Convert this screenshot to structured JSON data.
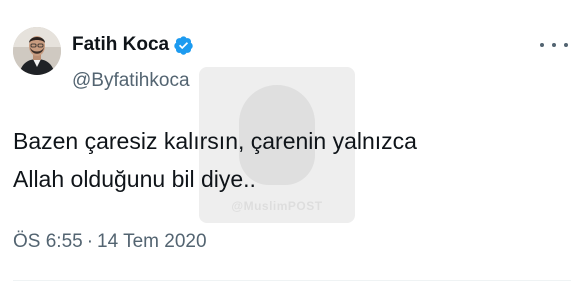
{
  "author": {
    "display_name": "Fatih Koca",
    "handle": "@Byfatihkoca",
    "verified": true,
    "avatar_icon": "profile-photo"
  },
  "tweet": {
    "text_lines": [
      "Bazen çaresiz kalırsın, çarenin yalnızca",
      "Allah olduğunu bil diye.."
    ]
  },
  "meta": {
    "time": "ÖS 6:55",
    "separator": "·",
    "date": "14 Tem 2020"
  },
  "watermark": {
    "text": "@MuslimPOST"
  },
  "colors": {
    "text": "#0f1419",
    "secondary": "#536471",
    "verified": "#1d9bf0",
    "divider": "#eff3f4"
  },
  "icons": {
    "more": "more-horizontal-icon",
    "verified": "verified-badge-icon"
  }
}
